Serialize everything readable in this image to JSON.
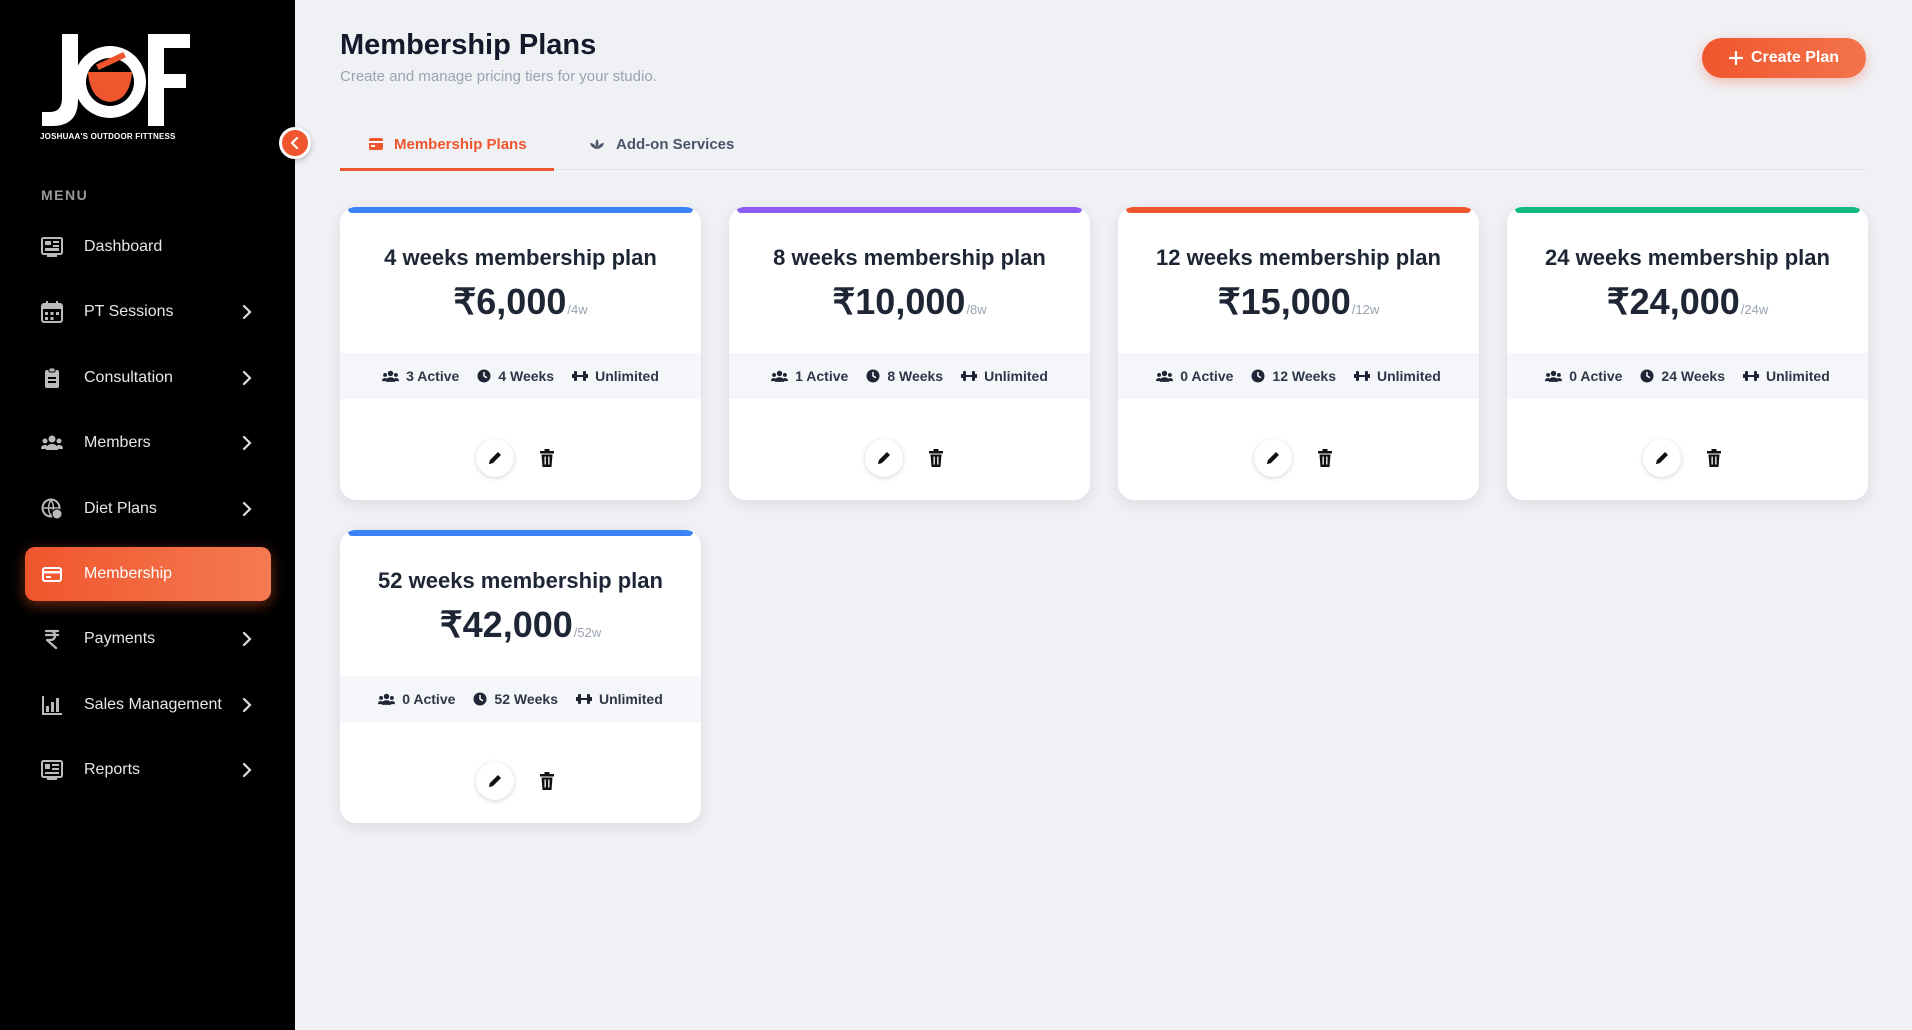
{
  "brand": {
    "logo_text": "JOF",
    "tagline": "JOSHUAA'S OUTDOOR FITTNESS",
    "accent": "#f0562d"
  },
  "sidebar": {
    "menu_heading": "MENU",
    "items": [
      {
        "label": "Dashboard",
        "icon": "dashboard-icon",
        "has_submenu": false,
        "active": false
      },
      {
        "label": "PT Sessions",
        "icon": "calendar-icon",
        "has_submenu": true,
        "active": false
      },
      {
        "label": "Consultation",
        "icon": "clipboard-icon",
        "has_submenu": true,
        "active": false
      },
      {
        "label": "Members",
        "icon": "users-icon",
        "has_submenu": true,
        "active": false
      },
      {
        "label": "Diet Plans",
        "icon": "globe-food-icon",
        "has_submenu": true,
        "active": false
      },
      {
        "label": "Membership",
        "icon": "credit-card-icon",
        "has_submenu": false,
        "active": true
      },
      {
        "label": "Payments",
        "icon": "rupee-icon",
        "has_submenu": true,
        "active": false
      },
      {
        "label": "Sales Management",
        "icon": "bar-chart-icon",
        "has_submenu": true,
        "active": false
      },
      {
        "label": "Reports",
        "icon": "report-icon",
        "has_submenu": true,
        "active": false
      }
    ]
  },
  "header": {
    "title": "Membership Plans",
    "subtitle": "Create and manage pricing tiers for your studio.",
    "create_button": "Create Plan"
  },
  "tabs": [
    {
      "label": "Membership Plans",
      "icon": "credit-card-icon",
      "active": true
    },
    {
      "label": "Add-on Services",
      "icon": "spa-icon",
      "active": false
    }
  ],
  "plans": [
    {
      "title": "4 weeks membership plan",
      "price": "₹6,000",
      "period": "/4w",
      "active": "3 Active",
      "duration": "4 Weeks",
      "access": "Unlimited",
      "color": "#3b82f6"
    },
    {
      "title": "8 weeks membership plan",
      "price": "₹10,000",
      "period": "/8w",
      "active": "1 Active",
      "duration": "8 Weeks",
      "access": "Unlimited",
      "color": "#8b5cf6"
    },
    {
      "title": "12 weeks membership plan",
      "price": "₹15,000",
      "period": "/12w",
      "active": "0 Active",
      "duration": "12 Weeks",
      "access": "Unlimited",
      "color": "#f0562d"
    },
    {
      "title": "24 weeks membership plan",
      "price": "₹24,000",
      "period": "/24w",
      "active": "0 Active",
      "duration": "24 Weeks",
      "access": "Unlimited",
      "color": "#10b981"
    },
    {
      "title": "52 weeks membership plan",
      "price": "₹42,000",
      "period": "/52w",
      "active": "0 Active",
      "duration": "52 Weeks",
      "access": "Unlimited",
      "color": "#3b82f6"
    }
  ]
}
